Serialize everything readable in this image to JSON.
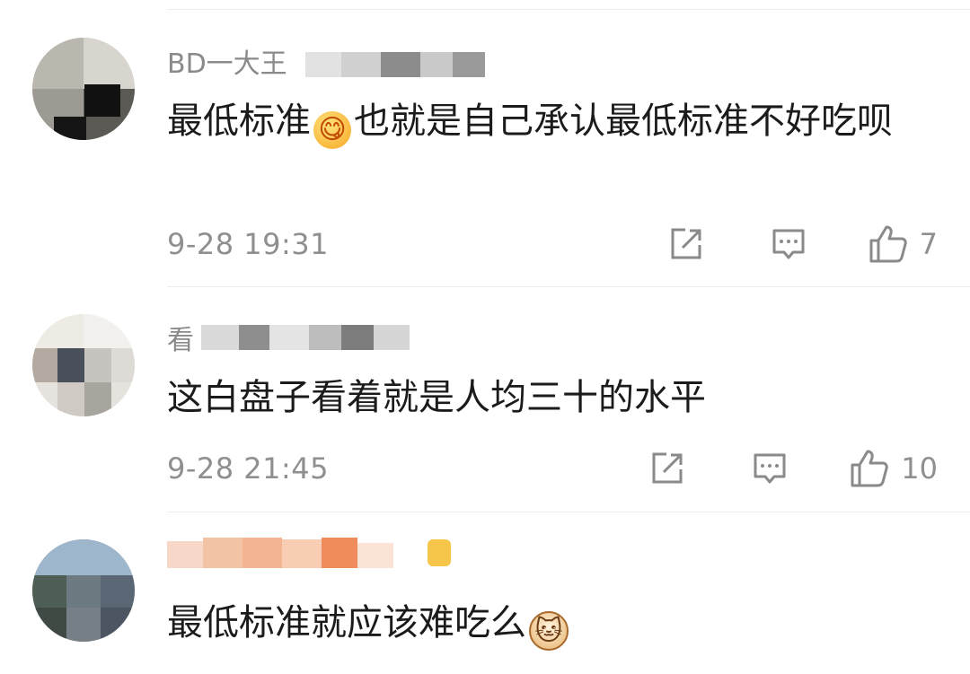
{
  "comments": [
    {
      "username": "BD一大王",
      "content_before": "最低标准",
      "emoji": "face-savoring-emoji",
      "emoji_glyph": "😋",
      "content_after": "也就是自己承认最低标准不好吃呗",
      "time": "9-28 19:31",
      "likes": "7"
    },
    {
      "username": "看",
      "content_before": "这白盘子看着就是人均三十的水平",
      "time": "9-28 21:45",
      "likes": "10"
    },
    {
      "username": "",
      "content_before": "最低标准就应该难吃么",
      "emoji": "cat-face-emoji",
      "emoji_glyph": "🐱"
    }
  ],
  "icons": {
    "share": "share-icon",
    "comment": "comment-icon",
    "like": "thumbs-up-icon"
  },
  "colors": {
    "text": "#1b1b1b",
    "meta": "#8f8f8f",
    "divider": "#ececec"
  }
}
